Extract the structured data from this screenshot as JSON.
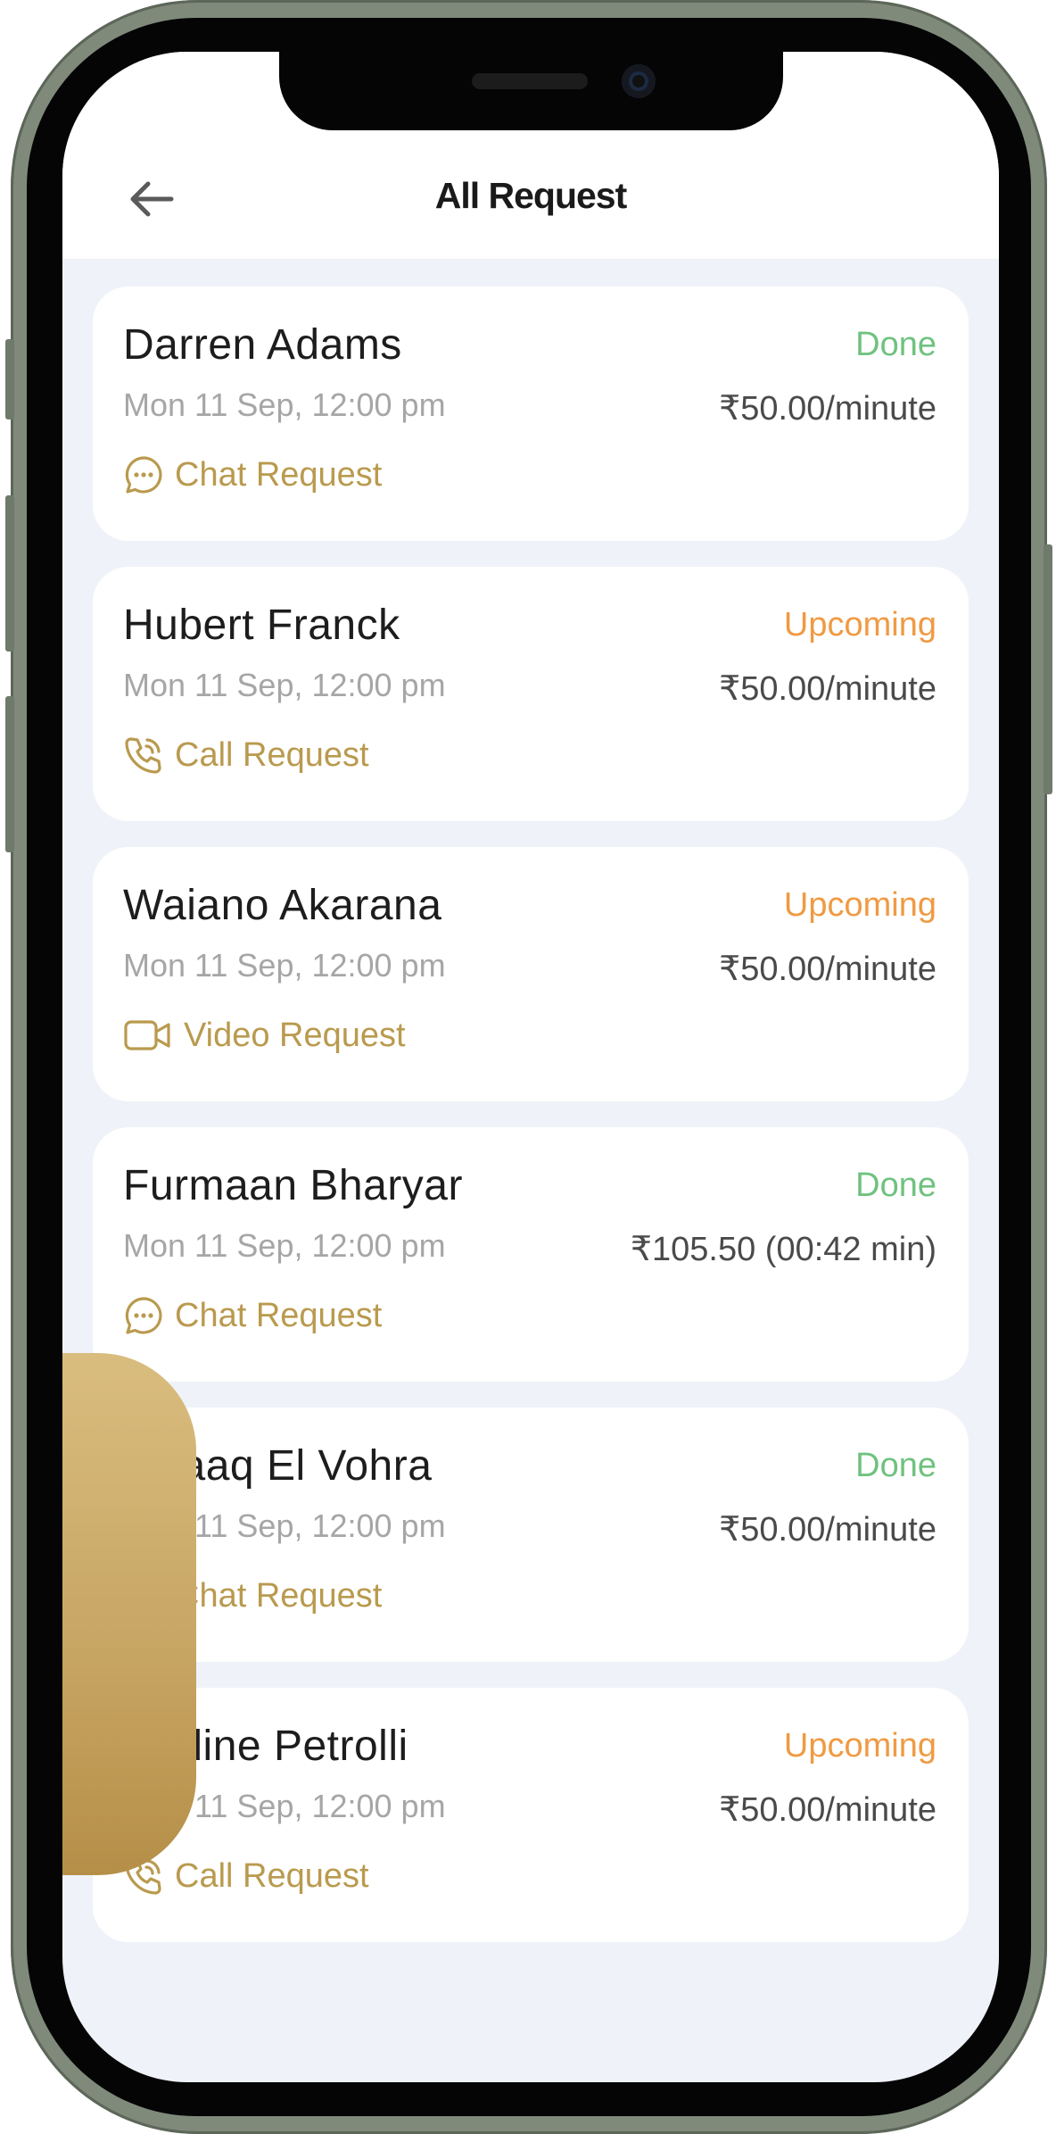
{
  "header": {
    "title": "All Request"
  },
  "colors": {
    "done": "#6fc27f",
    "upcoming": "#f09a43",
    "accent": "#b99a4e"
  },
  "requests": [
    {
      "name": "Darren Adams",
      "date": "Mon 11 Sep, 12:00 pm",
      "status": "Done",
      "status_color": "#6fc27f",
      "price": "₹50.00/minute",
      "type": "Chat Request",
      "icon": "chat-icon"
    },
    {
      "name": "Hubert Franck",
      "date": "Mon 11 Sep, 12:00 pm",
      "status": "Upcoming",
      "status_color": "#f09a43",
      "price": "₹50.00/minute",
      "type": "Call Request",
      "icon": "phone-icon"
    },
    {
      "name": "Waiano Akarana",
      "date": "Mon 11 Sep, 12:00 pm",
      "status": "Upcoming",
      "status_color": "#f09a43",
      "price": "₹50.00/minute",
      "type": "Video Request",
      "icon": "video-icon"
    },
    {
      "name": "Furmaan Bharyar",
      "date": "Mon 11 Sep, 12:00 pm",
      "status": "Done",
      "status_color": "#6fc27f",
      "price": "₹105.50  (00:42 min)",
      "type": "Chat Request",
      "icon": "chat-icon"
    },
    {
      "name": "Ishaaq El Vohra",
      "date": "Mon 11 Sep, 12:00 pm",
      "status": "Done",
      "status_color": "#6fc27f",
      "price": "₹50.00/minute",
      "type": "Chat Request",
      "icon": "chat-icon"
    },
    {
      "name": "Nadine Petrolli",
      "date": "Mon 11 Sep, 12:00 pm",
      "status": "Upcoming",
      "status_color": "#f09a43",
      "price": "₹50.00/minute",
      "type": "Call Request",
      "icon": "phone-icon"
    }
  ]
}
